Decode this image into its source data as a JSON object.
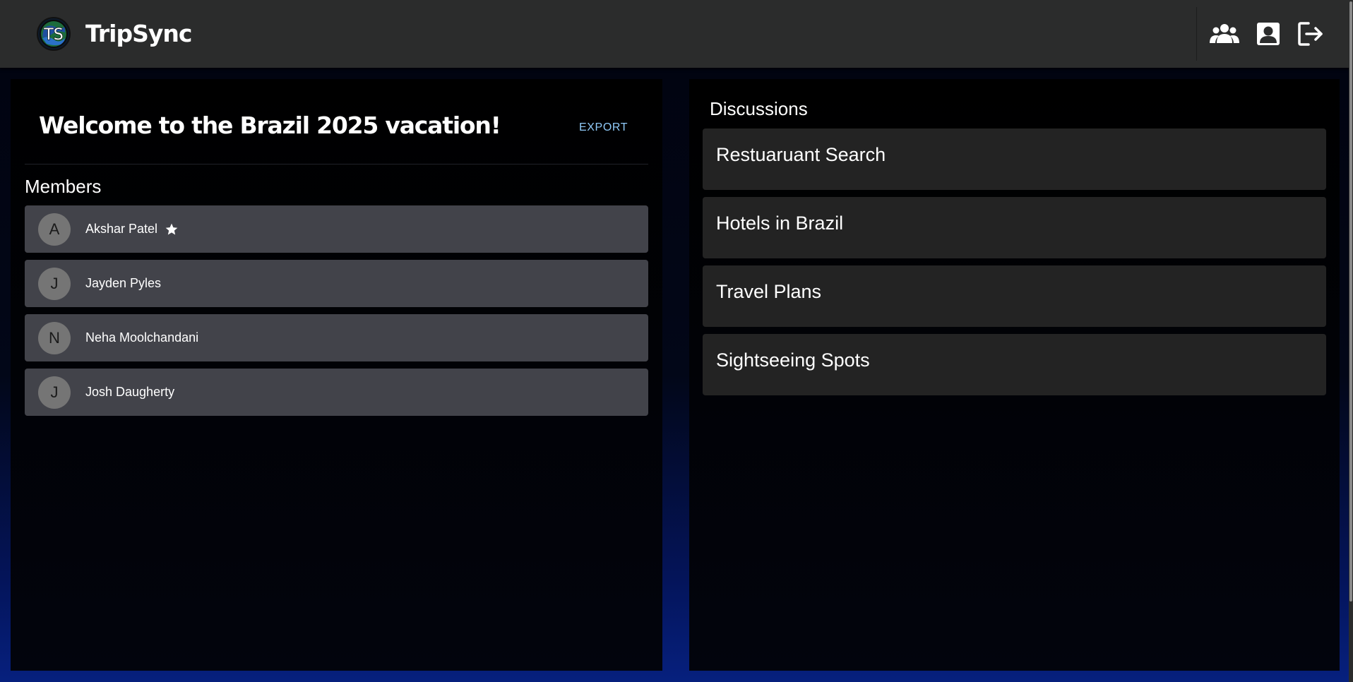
{
  "header": {
    "logo_text": "TS",
    "brand": "TripSync",
    "nav_icons": [
      "group-icon",
      "account-box-icon",
      "logout-icon"
    ]
  },
  "trip": {
    "welcome": "Welcome to the Brazil 2025 vacation!",
    "export_label": "EXPORT"
  },
  "members": {
    "heading": "Members",
    "items": [
      {
        "initial": "A",
        "name": "Akshar Patel",
        "is_owner": true
      },
      {
        "initial": "J",
        "name": "Jayden Pyles",
        "is_owner": false
      },
      {
        "initial": "N",
        "name": "Neha Moolchandani",
        "is_owner": false
      },
      {
        "initial": "J",
        "name": "Josh Daugherty",
        "is_owner": false
      }
    ]
  },
  "discussions": {
    "heading": "Discussions",
    "items": [
      {
        "title": "Restuaruant Search"
      },
      {
        "title": "Hotels in Brazil"
      },
      {
        "title": "Travel Plans"
      },
      {
        "title": "Sightseeing Spots"
      }
    ]
  },
  "colors": {
    "topbar": "#2b2c2c",
    "member_card": "#42434a",
    "discussion_card": "#232323",
    "export_accent": "#90caf9",
    "avatar_bg": "#757575"
  }
}
